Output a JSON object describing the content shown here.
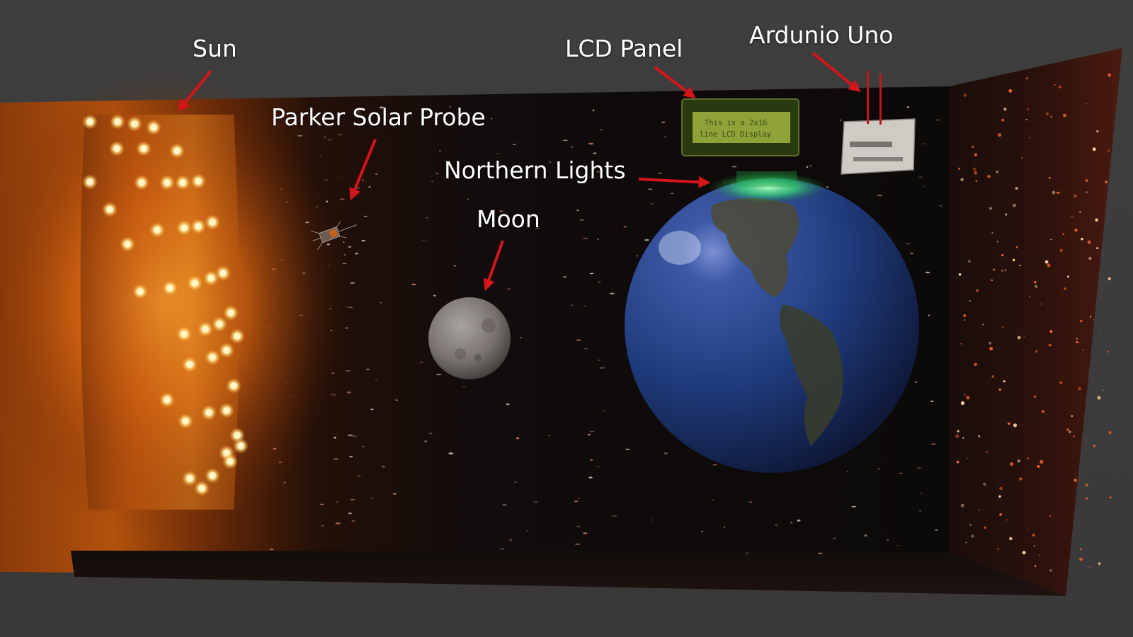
{
  "labels": {
    "sun": "Sun",
    "parker_solar_probe": "Parker Solar Probe",
    "lcd_panel": "LCD Panel",
    "arduino_uno": "Ardunio Uno",
    "northern_lights": "Northern Lights",
    "moon": "Moon"
  },
  "lcd_display": {
    "line1": "This is a 2x16",
    "line2": "line LCD Display"
  },
  "colors": {
    "background": "#3b3a3a",
    "arrow": "#d6141b",
    "label_text": "#ffffff",
    "sun_glow": "#ff9a1f",
    "led": "#fff3b0",
    "lcd_screen": "#8fa23a",
    "aurora": "#3cff6a",
    "earth_ocean": "#1f3f7a",
    "moon": "#8a8582"
  },
  "icons": {
    "sun": "sun-led-panel",
    "probe": "spacecraft",
    "lcd": "lcd-module",
    "arduino": "circuit-board",
    "earth": "globe",
    "moon": "moon"
  }
}
